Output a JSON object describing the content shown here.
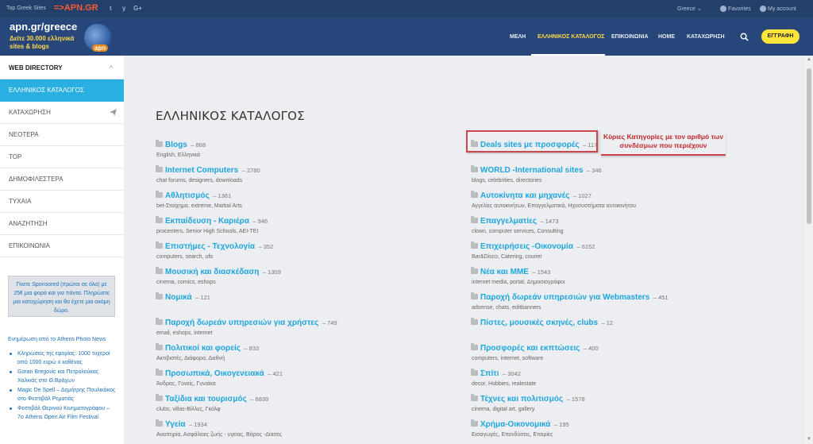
{
  "topbar": {
    "sites_label": "Top Greek Sites",
    "brand": "=>APN.GR",
    "social": [
      "t",
      "y",
      "G+"
    ],
    "country": "Greece ⌄",
    "favorites": "Favorites",
    "account": "My account"
  },
  "logo": {
    "title": "apn.gr/greece",
    "tagline": "Δείτε 30.000 ελληνικά sites & blogs",
    "mini": "apn"
  },
  "nav": {
    "items": [
      "ΜΕΛΗ",
      "ΕΛΛΗΝΙΚΟΣ ΚΑΤΑΛΟΓΟΣ",
      "ΕΠΙΚΟΙΝΩΝΙΑ",
      "HOME",
      "ΚΑΤΑΧΩΡΗΣΗ"
    ],
    "register": "ΕΓΓΡΑΦΗ"
  },
  "sidebar": {
    "items": [
      "WEB DIRECTORY",
      "ΕΛΛΗΝΙΚΟΣ ΚΑΤΑΛΟΓΟΣ",
      "ΚΑΤΑΧΩΡΗΣΗ",
      "ΝΕΟΤΕΡΑ",
      "TOP",
      "ΔΗΜΟΦΙΛΕΣΤΕΡΑ",
      "ΤΥΧΑΙΑ",
      "ΑΝΑΖΗΤΗΣΗ",
      "ΕΠΙΚΟΙΝΩΝΙΑ"
    ],
    "promo": "Γίνετε Sponsored (πρώτοι σε όλα) με 25€ μια φορά και για πάντα. Πληρώστε μια καταχώρηση και θα έχετε μια ακόμη δώρο.",
    "news_title": "Ενημέρωση από το Athens Photo News",
    "news": [
      "Κληρώσεις της εφορίας: 1000 τυχεροί από 1000 ευρώ ο καθένας",
      "Goran Bregovic και Πετρολούκας Χαλκιάς στο Θ.Βράχων",
      "Magic De Spell – Δημήτρης Πουλικάκος στο Φεστιβάλ Ρεματιάς",
      "Φεστιβάλ Θερινού Κινηματογράφου – 7ο Athens Open Air Film Festival"
    ]
  },
  "main": {
    "title": "ΕΛΛΗΝΙΚΟΣ ΚΑΤΑΛΟΓΟΣ",
    "annotation": "Κύριες Κατηγορίες με τον αριθμό των συνδέσμων που περιέχουν",
    "left": [
      {
        "name": "Blogs",
        "count": "– 868",
        "sub": "English, Ελληνικά"
      },
      {
        "name": "Internet Computers",
        "count": "– 2780",
        "sub": "chat forums, designers, downloads"
      },
      {
        "name": "Αθλητισμός",
        "count": "– 1361",
        "sub": "bet-Στοίχημα, extreme, Martial Arts"
      },
      {
        "name": "Εκπαίδευση - Καριέρα",
        "count": "– 946",
        "sub": "procenters, Senior High Schools, AEI-TEI"
      },
      {
        "name": "Επιστήμες - Τεχνολογία",
        "count": "– 352",
        "sub": "computers, search, ufo"
      },
      {
        "name": "Μουσική και διασκέδαση",
        "count": "– 1309",
        "sub": "cinema, comics, eshops"
      },
      {
        "name": "Νομικά",
        "count": "– 121",
        "sub": ""
      },
      {
        "name": "Παροχή δωρεάν υπηρεσιών για χρήστες",
        "count": "– 749",
        "sub": "email, eshops, internet"
      },
      {
        "name": "Πολιτικοί και φορείς",
        "count": "– 833",
        "sub": "Ακτιβιστές, Διάφορα, Διεθνή"
      },
      {
        "name": "Προσωπικά, Οικογενειακά",
        "count": "– 421",
        "sub": "Άνδρας, Γονείς, Γυναίκα"
      },
      {
        "name": "Ταξίδια και τουρισμός",
        "count": "– 6839",
        "sub": "clubs, villas-Βίλλες, Γκόλφ"
      },
      {
        "name": "Υγεία",
        "count": "– 1934",
        "sub": "Αναπηρία, Ασφάλειες ζωής - υγείας, Βάρος -Δίαιτες"
      }
    ],
    "right": [
      {
        "name": "Deals sites με προσφορές",
        "count": "– 117",
        "sub": ""
      },
      {
        "name": "WORLD -International sites",
        "count": "– 346",
        "sub": "blogs, celebrities, directories"
      },
      {
        "name": "Αυτοκίνητα και μηχανές",
        "count": "– 1027",
        "sub": "Αγγελίες αυτοκινήτων, Επαγγελματικά, Ηχοσυστήματα αυτοκινήτου"
      },
      {
        "name": "Επαγγελματίες",
        "count": "– 1473",
        "sub": "clown, computer services, Consulting"
      },
      {
        "name": "Επιχειρήσεις -Οικονομία",
        "count": "– 6152",
        "sub": "Bar&Disco, Catering, courier"
      },
      {
        "name": "Νέα και ΜΜΕ",
        "count": "– 1543",
        "sub": "internet media, portal, Δημοσιογράφοι"
      },
      {
        "name": "Παροχή δωρεάν υπηρεσιών για Webmasters",
        "count": "– 451",
        "sub": "adsense, chats, editbanners"
      },
      {
        "name": "Πίστες, μουσικές σκηνές, clubs",
        "count": "– 12",
        "sub": ""
      },
      {
        "name": "Προσφορές και εκπτώσεις",
        "count": "– 400",
        "sub": "computers, internet, software"
      },
      {
        "name": "Σπίτι",
        "count": "– 3042",
        "sub": "decor, Hobbies, realestate"
      },
      {
        "name": "Τέχνες και πολιτισμός",
        "count": "– 1578",
        "sub": "cinema, digital art, gallery"
      },
      {
        "name": "Χρήμα-Οικονομικά",
        "count": "– 195",
        "sub": "Εισαγωγές, Επενδύσεις, Εταιρίες"
      }
    ]
  }
}
